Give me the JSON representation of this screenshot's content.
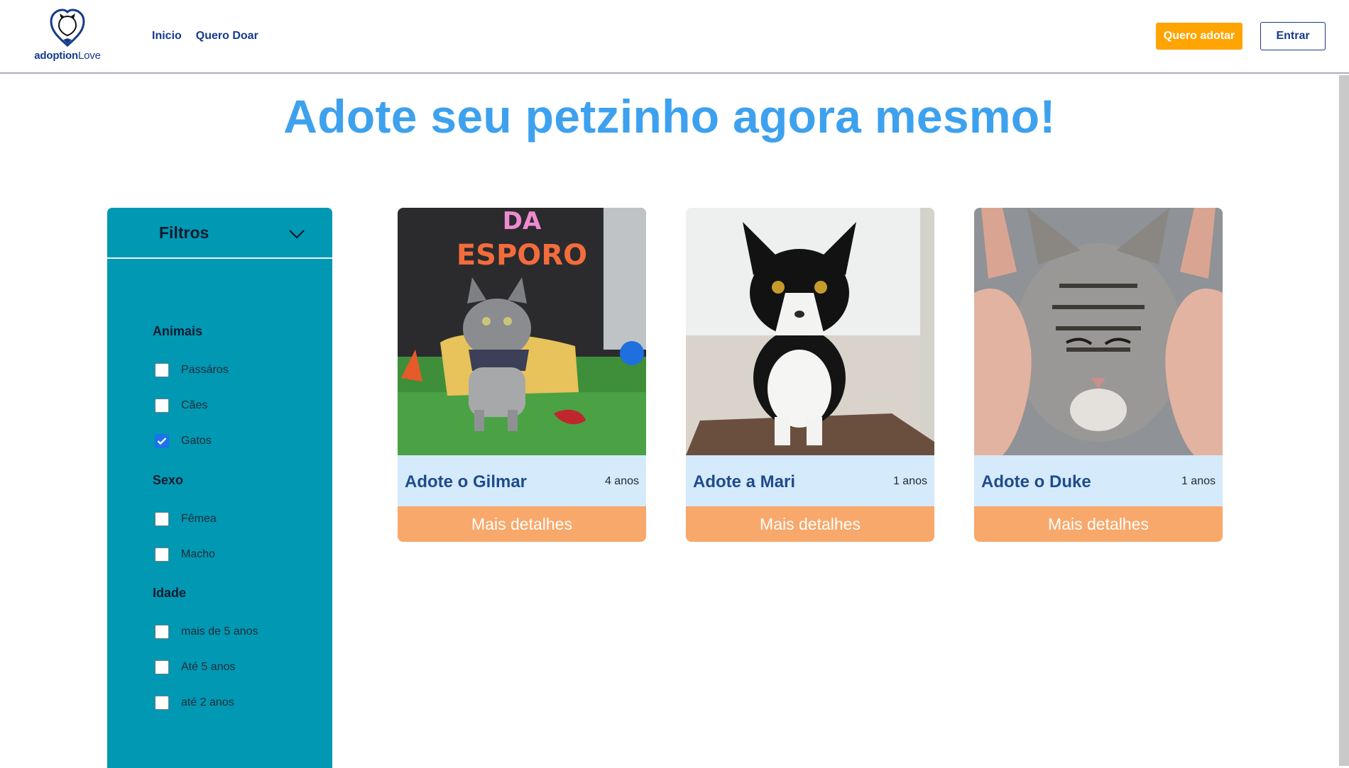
{
  "header": {
    "logo_text_bold": "adoption",
    "logo_text_light": "Love",
    "nav": [
      {
        "label": "Inicio"
      },
      {
        "label": "Quero Doar"
      }
    ],
    "adopt_button": "Quero adotar",
    "login_button": "Entrar",
    "colors": {
      "accent": "#ffa400",
      "brand": "#173a8a"
    }
  },
  "main": {
    "title": "Adote seu petzinho agora mesmo!"
  },
  "filters": {
    "title": "Filtros",
    "groups": [
      {
        "title": "Animais",
        "options": [
          {
            "label": "Passáros",
            "checked": false
          },
          {
            "label": "Cães",
            "checked": false
          },
          {
            "label": "Gatos",
            "checked": true
          }
        ]
      },
      {
        "title": "Sexo",
        "options": [
          {
            "label": "Fêmea",
            "checked": false
          },
          {
            "label": "Macho",
            "checked": false
          }
        ]
      },
      {
        "title": "Idade",
        "options": [
          {
            "label": "mais de 5 anos",
            "checked": false
          },
          {
            "label": "Até 5 anos",
            "checked": false
          },
          {
            "label": "até 2 anos",
            "checked": false
          }
        ]
      }
    ]
  },
  "cards": [
    {
      "name": "Adote o Gilmar",
      "age": "4 anos",
      "button": "Mais detalhes",
      "photo_sign_1": "DA",
      "photo_sign_2": "ESPORO"
    },
    {
      "name": "Adote a Mari",
      "age": "1 anos",
      "button": "Mais detalhes"
    },
    {
      "name": "Adote o Duke",
      "age": "1 anos",
      "button": "Mais detalhes"
    }
  ]
}
